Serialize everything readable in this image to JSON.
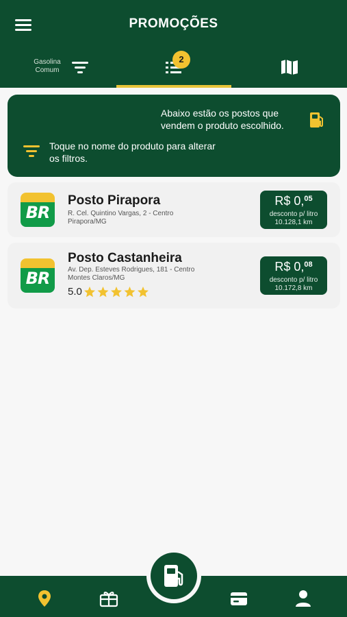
{
  "header": {
    "title": "PROMOÇÕES",
    "fuel_filter_label": "Gasolina Comum",
    "list_badge": "2"
  },
  "info": {
    "line1": "Abaixo estão os postos que vendem o produto escolhido.",
    "line2": "Toque no nome do produto para alterar os filtros."
  },
  "stations": [
    {
      "name": "Posto Pirapora",
      "address": "R. Cel. Quintino Vargas, 2 - Centro",
      "city": "Pirapora/MG",
      "price_prefix": "R$ 0,",
      "price_cents": "05",
      "discount_label": "desconto p/ litro",
      "distance": "10.128,1 km"
    },
    {
      "name": "Posto Castanheira",
      "address": "Av. Dep. Esteves Rodrigues, 181 - Centro",
      "city": "Montes Claros/MG",
      "rating": "5.0",
      "stars": 5,
      "price_prefix": "R$ 0,",
      "price_cents": "08",
      "discount_label": "desconto p/ litro",
      "distance": "10.172,8 km"
    }
  ],
  "brand_logo_text": "BR",
  "colors": {
    "primary": "#0d4d2f",
    "accent": "#f2c230",
    "background": "#f7f7f7"
  },
  "icons": {
    "menu": "menu-icon",
    "filter": "filter-icon",
    "list": "list-icon",
    "map": "map-icon",
    "fuel_pump": "fuel-pump-icon",
    "location": "location-pin-icon",
    "gift": "gift-icon",
    "wallet": "wallet-icon",
    "profile": "user-icon"
  }
}
